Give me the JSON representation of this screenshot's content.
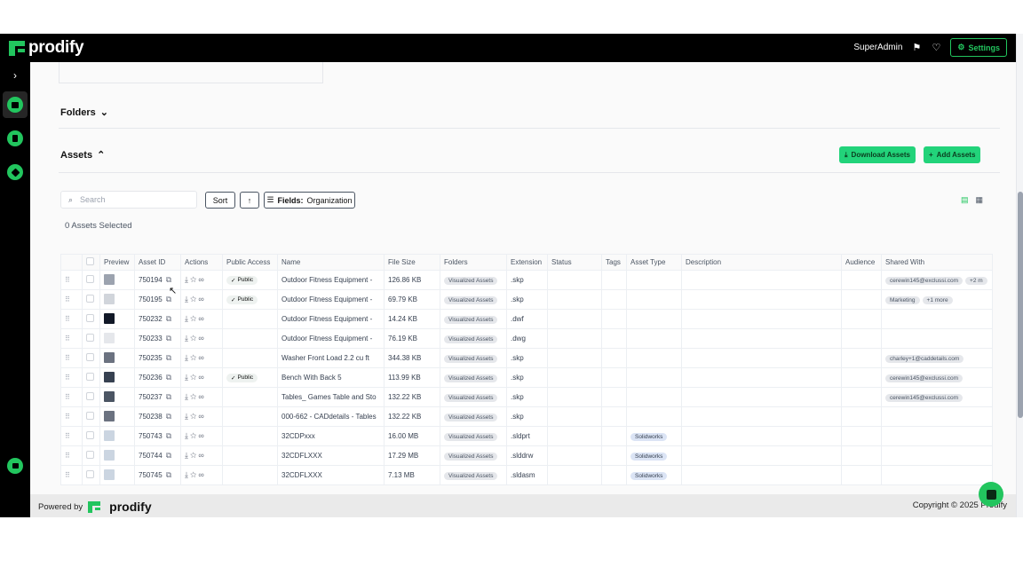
{
  "app": {
    "brand": "prodify",
    "colors": {
      "accent": "#22c55e",
      "topbar": "#000000"
    }
  },
  "topbar": {
    "user": "SuperAdmin",
    "flag_icon": "flag-icon",
    "bulb_icon": "lightbulb-icon",
    "settings_label": "Settings"
  },
  "sidebar": {
    "expand_icon": "chevron-right-icon",
    "items": [
      "assets-icon",
      "documents-icon",
      "tags-icon",
      "analytics-icon"
    ]
  },
  "folders": {
    "title": "Folders"
  },
  "assets": {
    "title": "Assets",
    "download_label": "Download Assets",
    "add_label": "Add Assets"
  },
  "toolbar": {
    "search_placeholder": "Search",
    "sort_label": "Sort",
    "fields_label": "Fields:",
    "fields_value": "Organization",
    "selected_text": "0 Assets Selected"
  },
  "table": {
    "headers": [
      "Preview",
      "Asset ID",
      "Actions",
      "Public Access",
      "Name",
      "File Size",
      "Folders",
      "Extension",
      "Status",
      "Tags",
      "Asset Type",
      "Description",
      "Audience",
      "Shared With"
    ],
    "rows": [
      {
        "id": "750194",
        "public": "Public",
        "name": "Outdoor Fitness Equipment -",
        "size": "126.86 KB",
        "folder": "Visualized Assets",
        "ext": ".skp",
        "type": "",
        "shared": [
          "cerewin145@exclussi.com",
          "+2 m"
        ]
      },
      {
        "id": "750195",
        "public": "Public",
        "name": "Outdoor Fitness Equipment -",
        "size": "69.79 KB",
        "folder": "Visualized Assets",
        "ext": ".skp",
        "type": "",
        "shared": [
          "Marketing",
          "+1 more"
        ]
      },
      {
        "id": "750232",
        "public": "",
        "name": "Outdoor Fitness Equipment -",
        "size": "14.24 KB",
        "folder": "Visualized Assets",
        "ext": ".dwf",
        "type": "",
        "shared": []
      },
      {
        "id": "750233",
        "public": "",
        "name": "Outdoor Fitness Equipment -",
        "size": "76.19 KB",
        "folder": "Visualized Assets",
        "ext": ".dwg",
        "type": "",
        "shared": []
      },
      {
        "id": "750235",
        "public": "",
        "name": "Washer Front Load 2.2 cu ft",
        "size": "344.38 KB",
        "folder": "Visualized Assets",
        "ext": ".skp",
        "type": "",
        "shared": [
          "charley+1@caddetails.com"
        ]
      },
      {
        "id": "750236",
        "public": "Public",
        "name": "Bench With Back 5",
        "size": "113.99 KB",
        "folder": "Visualized Assets",
        "ext": ".skp",
        "type": "",
        "shared": [
          "cerewin145@exclussi.com"
        ]
      },
      {
        "id": "750237",
        "public": "",
        "name": "Tables_ Games Table and Sto",
        "size": "132.22 KB",
        "folder": "Visualized Assets",
        "ext": ".skp",
        "type": "",
        "shared": [
          "cerewin145@exclussi.com"
        ]
      },
      {
        "id": "750238",
        "public": "",
        "name": "000-662 - CADdetails - Tables",
        "size": "132.22 KB",
        "folder": "Visualized Assets",
        "ext": ".skp",
        "type": "",
        "shared": []
      },
      {
        "id": "750743",
        "public": "",
        "name": "32CDPxxx",
        "size": "16.00 MB",
        "folder": "Visualized Assets",
        "ext": ".sldprt",
        "type": "Solidworks",
        "shared": []
      },
      {
        "id": "750744",
        "public": "",
        "name": "32CDFLXXX",
        "size": "17.29 MB",
        "folder": "Visualized Assets",
        "ext": ".slddrw",
        "type": "Solidworks",
        "shared": []
      },
      {
        "id": "750745",
        "public": "",
        "name": "32CDFLXXX",
        "size": "7.13 MB",
        "folder": "Visualized Assets",
        "ext": ".sldasm",
        "type": "Solidworks",
        "shared": []
      }
    ]
  },
  "footer": {
    "powered_by": "Powered by",
    "brand": "prodify",
    "copyright": "Copyright © 2025 Prodify"
  }
}
